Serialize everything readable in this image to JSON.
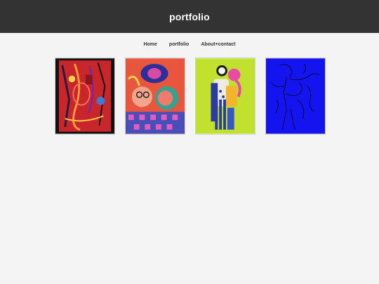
{
  "header": {
    "title": "portfolio",
    "background": "#333333"
  },
  "nav": {
    "items": [
      {
        "label": "Home"
      },
      {
        "label": "portfolio"
      },
      {
        "label": "About+contact"
      }
    ]
  },
  "gallery": {
    "items": [
      {
        "icon": "abstract-red-painting"
      },
      {
        "icon": "colorful-faces-painting"
      },
      {
        "icon": "green-figures-painting"
      },
      {
        "icon": "blue-line-drawing"
      }
    ]
  }
}
